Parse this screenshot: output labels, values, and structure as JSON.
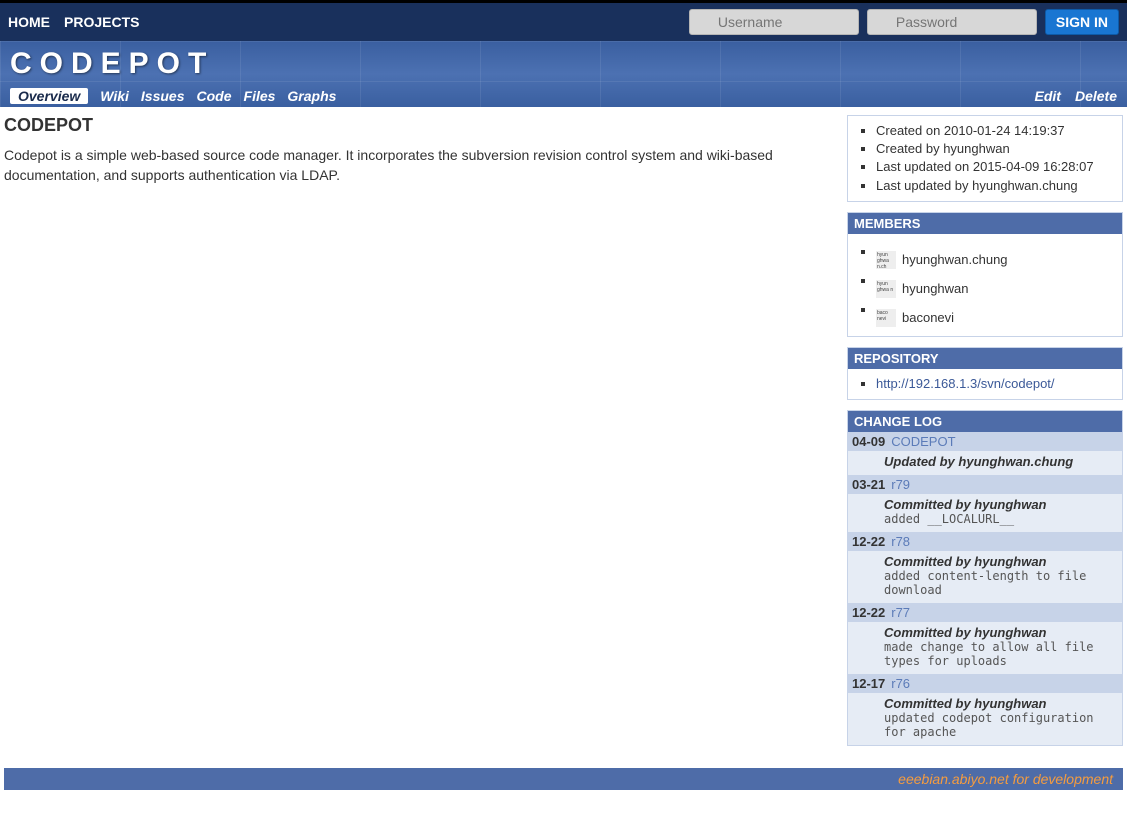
{
  "topnav": {
    "home": "HOME",
    "projects": "PROJECTS"
  },
  "login": {
    "username_placeholder": "Username",
    "password_placeholder": "Password",
    "signin": "SIGN IN"
  },
  "banner": {
    "title": "CODEPOT"
  },
  "tabs": {
    "overview": "Overview",
    "wiki": "Wiki",
    "issues": "Issues",
    "code": "Code",
    "files": "Files",
    "graphs": "Graphs"
  },
  "actions": {
    "edit": "Edit",
    "delete": "Delete"
  },
  "project": {
    "name": "CODEPOT",
    "description": "Codepot is a simple web-based source code manager. It incorporates the subversion revision control system and wiki-based documentation, and supports authentication via LDAP."
  },
  "info": {
    "created_on": "Created on 2010-01-24 14:19:37",
    "created_by": "Created by hyunghwan",
    "updated_on": "Last updated on 2015-04-09 16:28:07",
    "updated_by": "Last updated by hyunghwan.chung"
  },
  "members": {
    "header": "MEMBERS",
    "items": [
      {
        "name": "hyunghwan.chung",
        "avatar": "hyun ghwa n.ch"
      },
      {
        "name": "hyunghwan",
        "avatar": "hyun ghwa n"
      },
      {
        "name": "baconevi",
        "avatar": "baco nevi"
      }
    ]
  },
  "repository": {
    "header": "REPOSITORY",
    "url": "http://192.168.1.3/svn/codepot/"
  },
  "changelog": {
    "header": "CHANGE LOG",
    "entries": [
      {
        "date": "04-09",
        "rev": "CODEPOT",
        "committer": "Updated by hyunghwan.chung",
        "msg": ""
      },
      {
        "date": "03-21",
        "rev": "r79",
        "committer": "Committed by hyunghwan",
        "msg": "added __LOCALURL__"
      },
      {
        "date": "12-22",
        "rev": "r78",
        "committer": "Committed by hyunghwan",
        "msg": "added content-length to file download"
      },
      {
        "date": "12-22",
        "rev": "r77",
        "committer": "Committed by hyunghwan",
        "msg": "made change to allow all file types for uploads"
      },
      {
        "date": "12-17",
        "rev": "r76",
        "committer": "Committed by hyunghwan",
        "msg": "updated codepot configuration for apache"
      }
    ]
  },
  "footer": {
    "text": "eeebian.abiyo.net for development"
  }
}
